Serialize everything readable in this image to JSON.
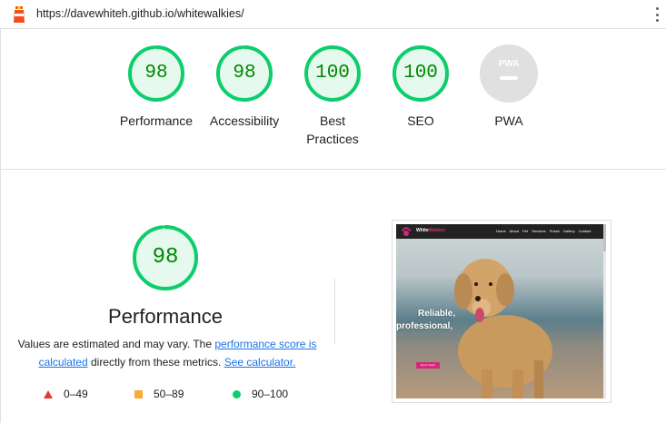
{
  "topbar": {
    "url": "https://davewhiteh.github.io/whitewalkies/",
    "logo_icon": "lighthouse-icon",
    "menu_icon": "kebab-menu-icon"
  },
  "categories": [
    {
      "score": "98",
      "label": "Performance",
      "fraction": 0.98
    },
    {
      "score": "98",
      "label": "Accessibility",
      "fraction": 0.98
    },
    {
      "score": "100",
      "label": "Best Practices",
      "fraction": 1.0
    },
    {
      "score": "100",
      "label": "SEO",
      "fraction": 1.0
    },
    {
      "score": "",
      "label": "PWA",
      "badge": "PWA"
    }
  ],
  "performance": {
    "score": "98",
    "fraction": 0.98,
    "title": "Performance",
    "desc_prefix": "Values are estimated and may vary. The ",
    "link_score": "performance score is calculated",
    "desc_middle": " directly from these metrics. ",
    "link_calc": "See calculator."
  },
  "legend": [
    {
      "range": "0–49",
      "shape": "triangle",
      "color": "#e53935"
    },
    {
      "range": "50–89",
      "shape": "square",
      "color": "#fbaa33"
    },
    {
      "range": "90–100",
      "shape": "circle",
      "color": "#0cce6b"
    }
  ],
  "screenshot": {
    "brand_prefix": "White",
    "brand_suffix": "Walkies",
    "menu": "Home About Pet Services Prices Gallery Contact",
    "hero_line1": "Reliable,",
    "hero_line2": "professional,",
    "button": "Get in touch"
  },
  "colors": {
    "pass": "#0cce6b",
    "pass_text": "#008800",
    "pass_fill": "#e5f9ee",
    "pwa_gray": "#e0e0e0",
    "link": "#1a73e8"
  }
}
